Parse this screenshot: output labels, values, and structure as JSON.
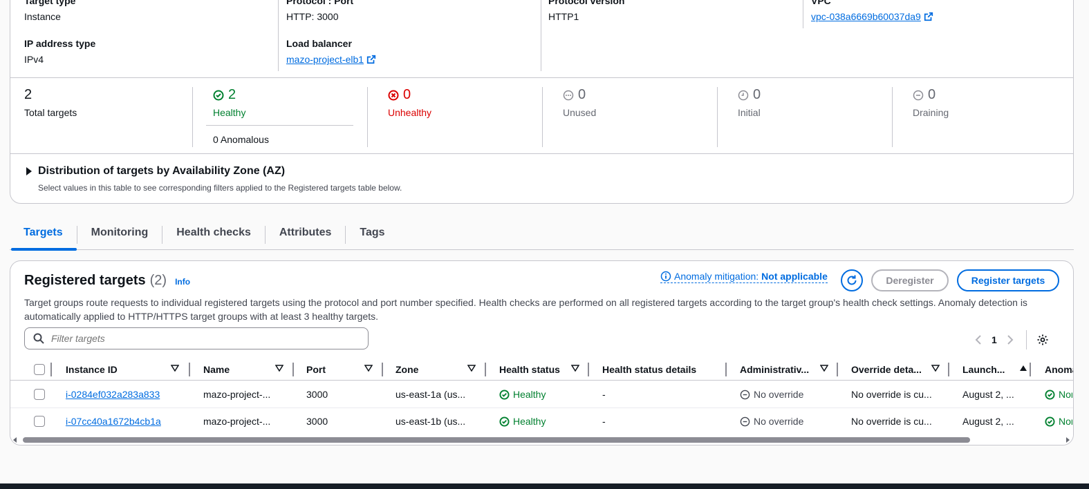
{
  "details": {
    "target_type": {
      "label": "Target type",
      "value": "Instance"
    },
    "protocol_port": {
      "label": "Protocol : Port",
      "value": "HTTP: 3000"
    },
    "protocol_version": {
      "label": "Protocol version",
      "value": "HTTP1"
    },
    "vpc": {
      "label": "VPC",
      "value": "vpc-038a6669b60037da9"
    },
    "ip_address_type": {
      "label": "IP address type",
      "value": "IPv4"
    },
    "load_balancer": {
      "label": "Load balancer",
      "value": "mazo-project-elb1"
    }
  },
  "stats": {
    "total": {
      "value": "2",
      "label": "Total targets"
    },
    "healthy": {
      "value": "2",
      "label": "Healthy",
      "anomalous": "0 Anomalous"
    },
    "unhealthy": {
      "value": "0",
      "label": "Unhealthy"
    },
    "unused": {
      "value": "0",
      "label": "Unused"
    },
    "initial": {
      "value": "0",
      "label": "Initial"
    },
    "draining": {
      "value": "0",
      "label": "Draining"
    }
  },
  "az": {
    "title": "Distribution of targets by Availability Zone (AZ)",
    "description": "Select values in this table to see corresponding filters applied to the Registered targets table below."
  },
  "tabs": [
    "Targets",
    "Monitoring",
    "Health checks",
    "Attributes",
    "Tags"
  ],
  "registered": {
    "title": "Registered targets",
    "count": "(2)",
    "info": "Info",
    "description": "Target groups route requests to individual registered targets using the protocol and port number specified. Health checks are performed on all registered targets according to the target group's health check settings. Anomaly detection is automatically applied to HTTP/HTTPS target groups with at least 3 healthy targets.",
    "anomaly_label": "Anomaly mitigation:",
    "anomaly_value": "Not applicable",
    "deregister": "Deregister",
    "register": "Register targets",
    "filter_placeholder": "Filter targets",
    "page": "1"
  },
  "table": {
    "columns": [
      "Instance ID",
      "Name",
      "Port",
      "Zone",
      "Health status",
      "Health status details",
      "Administrativ...",
      "Override deta...",
      "Launch...",
      "Anoma"
    ],
    "rows": [
      {
        "instance_id": "i-0284ef032a283a833",
        "name": "mazo-project-...",
        "port": "3000",
        "zone": "us-east-1a (us...",
        "health": "Healthy",
        "details": "-",
        "admin": "No override",
        "override": "No override is cu...",
        "launch": "August 2, ...",
        "anomaly": "Nor"
      },
      {
        "instance_id": "i-07cc40a1672b4cb1a",
        "name": "mazo-project-...",
        "port": "3000",
        "zone": "us-east-1b (us...",
        "health": "Healthy",
        "details": "-",
        "admin": "No override",
        "override": "No override is cu...",
        "launch": "August 2, ...",
        "anomaly": "Nor"
      }
    ]
  },
  "colors": {
    "accent": "#006ce0",
    "healthy": "#00802f",
    "unhealthy": "#db0000"
  }
}
